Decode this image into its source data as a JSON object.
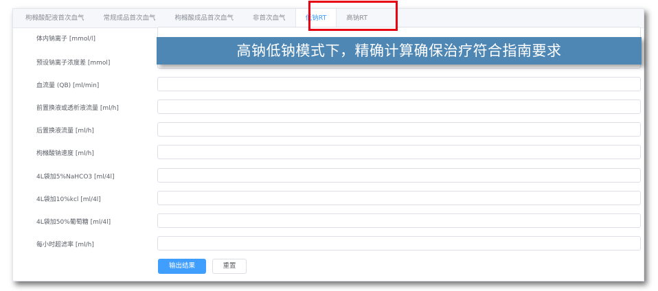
{
  "tabs": [
    {
      "label": "枸橼酸配液首次血气",
      "active": false
    },
    {
      "label": "常规成品首次血气",
      "active": false
    },
    {
      "label": "枸橼酸成品首次血气",
      "active": false
    },
    {
      "label": "非首次血气",
      "active": false
    },
    {
      "label": "低钠RT",
      "active": true
    },
    {
      "label": "高钠RT",
      "active": false
    }
  ],
  "banner": {
    "text": "高钠低钠模式下，精确计算确保治疗符合指南要求"
  },
  "form": {
    "rows": [
      {
        "label": "体内钠离子 [mmol/l]",
        "value": ""
      },
      {
        "label": "预设钠离子浓度差 [mmol]",
        "value": ""
      },
      {
        "label": "血流量 (QB) [ml/min]",
        "value": ""
      },
      {
        "label": "前置换液或透析液流量 [ml/h]",
        "value": ""
      },
      {
        "label": "后置换液流量 [ml/h]",
        "value": ""
      },
      {
        "label": "枸橼酸钠速度 [ml/h]",
        "value": ""
      },
      {
        "label": "4L袋加5%NaHCO3 [ml/4l]",
        "value": ""
      },
      {
        "label": "4L袋加10%kcl [ml/4l]",
        "value": ""
      },
      {
        "label": "4L袋加50%葡萄糖 [ml/4l]",
        "value": ""
      },
      {
        "label": "每小时超滤率 [ml/h]",
        "value": ""
      }
    ]
  },
  "buttons": {
    "submit_label": "输出结果",
    "reset_label": "重置"
  },
  "colors": {
    "highlight": "#e60012",
    "banner": "#4e86b4",
    "primary": "#409eff"
  }
}
